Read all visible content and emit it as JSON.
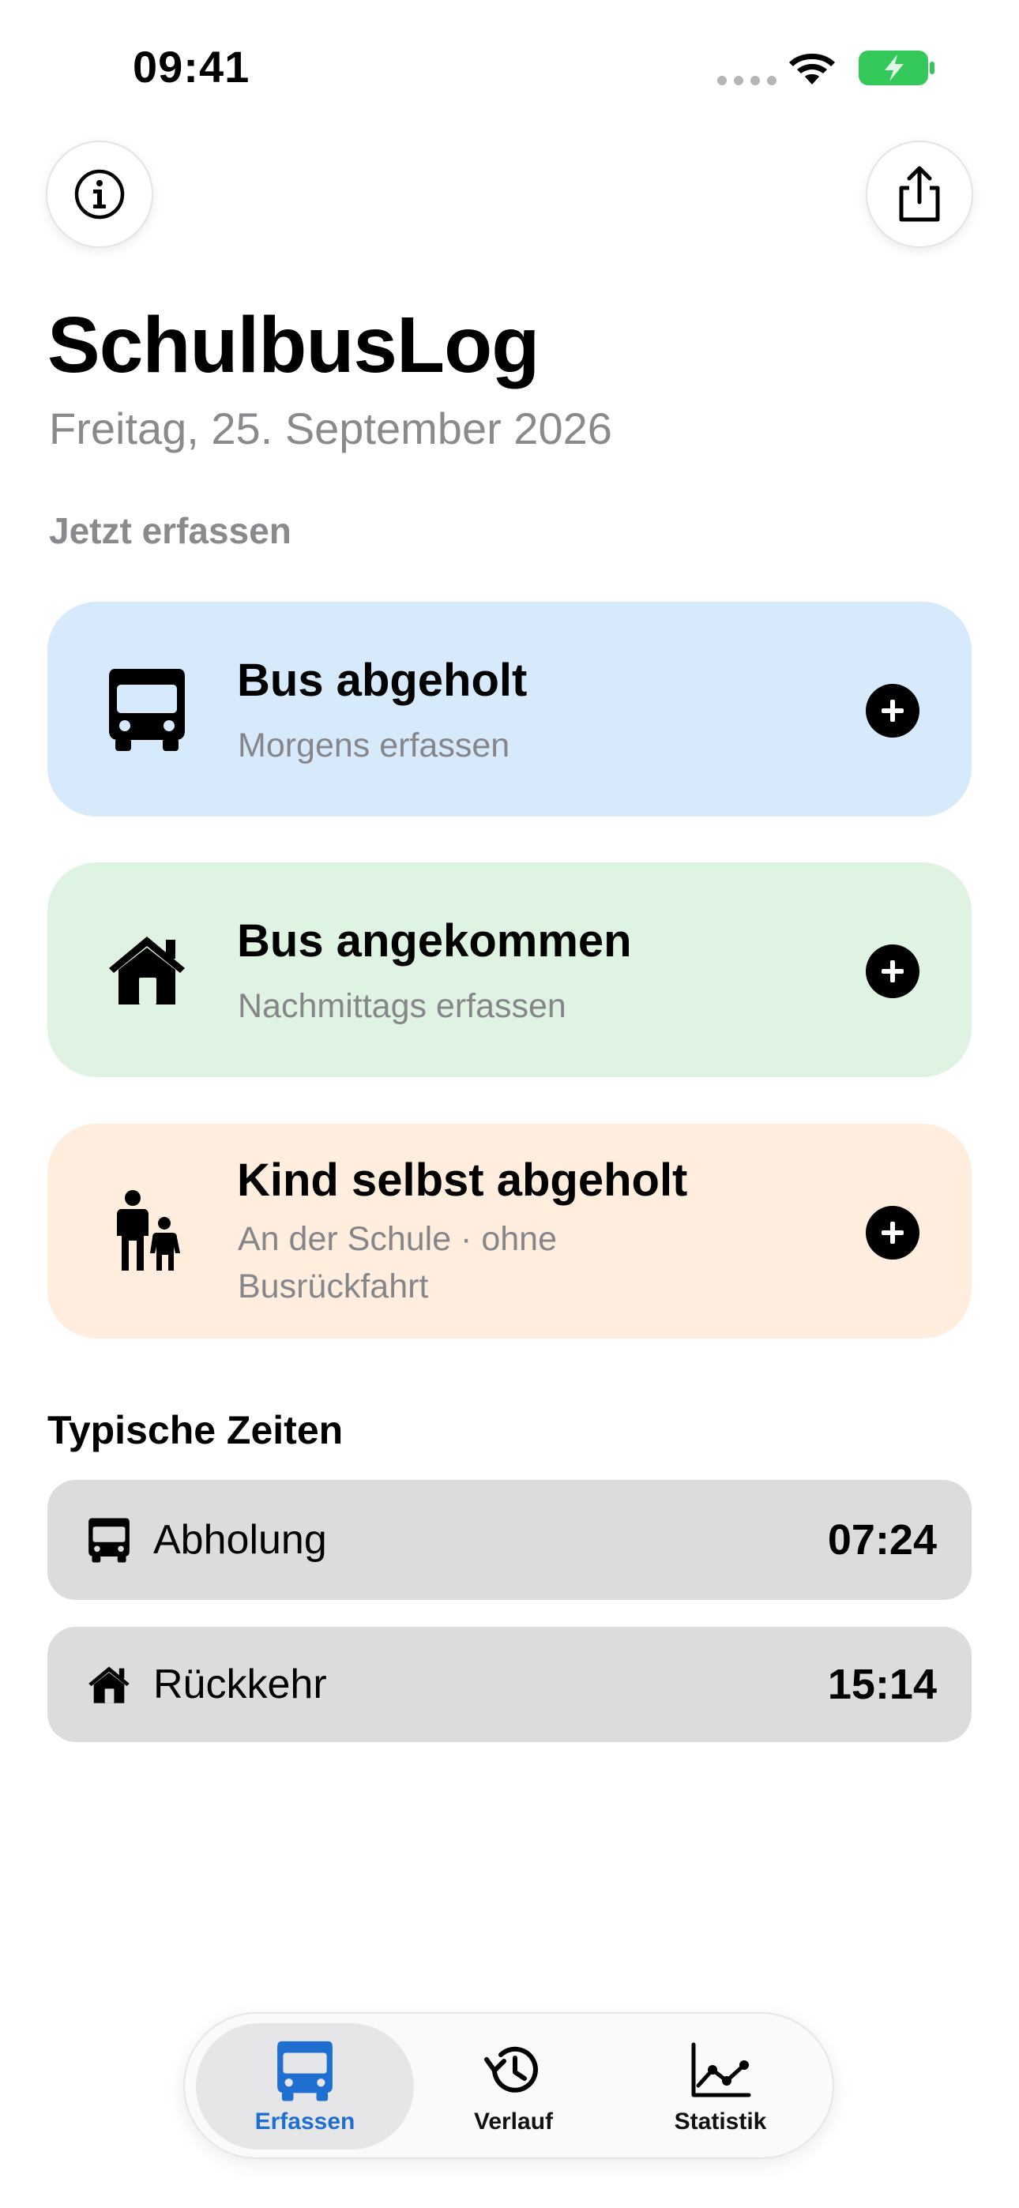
{
  "status_bar": {
    "time": "09:41"
  },
  "header": {
    "info_icon": "info-circle-icon",
    "share_icon": "share-icon"
  },
  "app": {
    "title": "SchulbusLog",
    "date": "Freitag, 25. September 2026",
    "section_label": "Jetzt erfassen"
  },
  "actions": [
    {
      "title": "Bus abgeholt",
      "subtitle": "Morgens erfassen",
      "icon": "bus-icon",
      "color": "#d6eafc"
    },
    {
      "title": "Bus angekommen",
      "subtitle": "Nachmittags erfassen",
      "icon": "house-icon",
      "color": "#dff3e2"
    },
    {
      "title": "Kind selbst abgeholt",
      "subtitle": "An der Schule · ohne Busrückfahrt",
      "icon": "parent-child-icon",
      "color": "#ffeddd"
    }
  ],
  "typical_times": {
    "title": "Typische Zeiten",
    "rows": [
      {
        "label": "Abholung",
        "value": "07:24",
        "icon": "bus-icon"
      },
      {
        "label": "Rückkehr",
        "value": "15:14",
        "icon": "house-icon"
      }
    ]
  },
  "tab_bar": {
    "tabs": [
      {
        "label": "Erfassen",
        "icon": "bus-icon",
        "active": true
      },
      {
        "label": "Verlauf",
        "icon": "history-icon",
        "active": false
      },
      {
        "label": "Statistik",
        "icon": "line-chart-icon",
        "active": false
      }
    ],
    "accent_color": "#1f6fd0"
  }
}
